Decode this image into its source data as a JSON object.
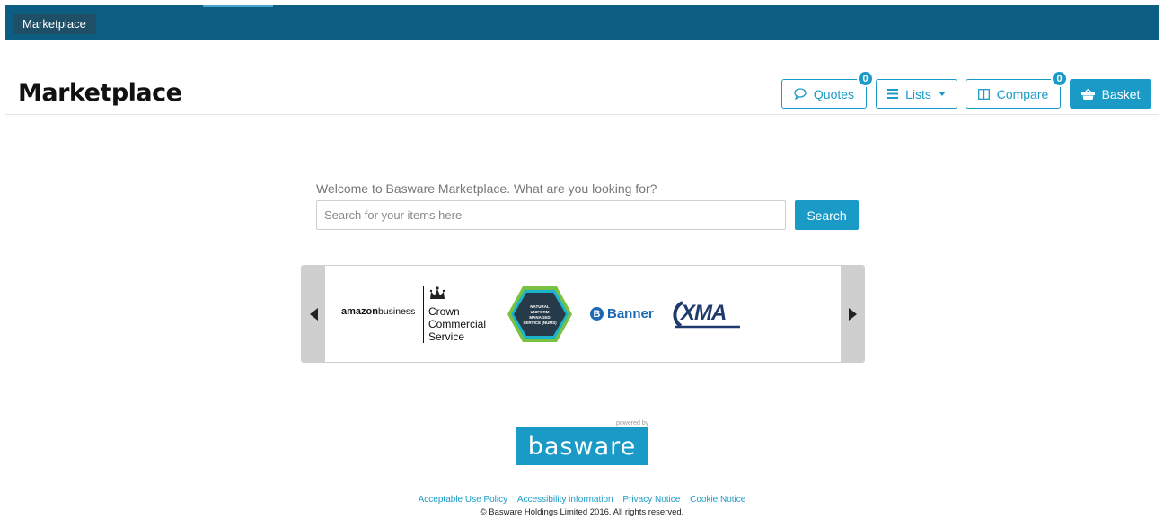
{
  "topbar": {
    "breadcrumb": "Marketplace"
  },
  "page": {
    "title": "Marketplace"
  },
  "header_buttons": {
    "quotes_label": "Quotes",
    "quotes_count": "0",
    "lists_label": "Lists",
    "compare_label": "Compare",
    "compare_count": "0",
    "basket_label": "Basket"
  },
  "search": {
    "welcome": "Welcome to Basware Marketplace. What are you looking for?",
    "placeholder": "Search for your items here",
    "value": "",
    "button_label": "Search"
  },
  "carousel": {
    "logos": [
      {
        "name": "amazon-business",
        "text_bold": "amazon",
        "text": "business"
      },
      {
        "name": "crown-commercial-service",
        "lines": [
          "Crown",
          "Commercial",
          "Service"
        ]
      },
      {
        "name": "natural-uniform-service",
        "text": "NATURAL UNIFORM MANAGED SERVICE (NUMS)"
      },
      {
        "name": "banner",
        "letter": "B",
        "text": "Banner"
      },
      {
        "name": "xma",
        "text": "XMA"
      }
    ]
  },
  "footer": {
    "powered_by": "powered by",
    "brand": "basware",
    "links": [
      "Acceptable Use Policy",
      "Accessibility information",
      "Privacy Notice",
      "Cookie Notice"
    ],
    "copyright": "© Basware Holdings Limited 2016. All rights reserved."
  },
  "colors": {
    "topbar": "#0c5f83",
    "accent": "#1a9bc7"
  }
}
